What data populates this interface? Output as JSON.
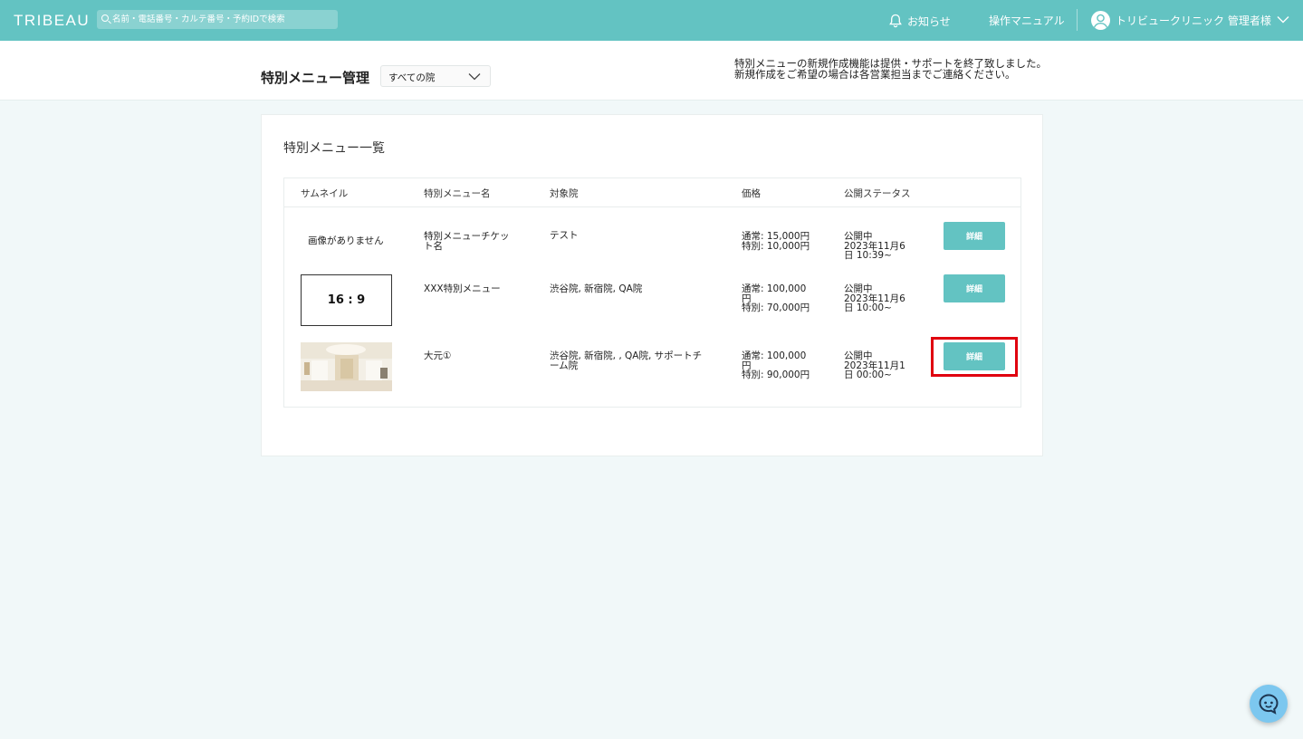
{
  "topbar": {
    "brand": "TRIBEAU",
    "search_placeholder": "名前・電話番号・カルテ番号・予約IDで検索",
    "notifications_label": "お知らせ",
    "manual_label": "操作マニュアル",
    "user_label": "トリビュークリニック 管理者様",
    "colors": {
      "bar": "#63c3c2"
    }
  },
  "subheader": {
    "title": "特別メニュー管理",
    "clinic_select": "すべての院",
    "notice_line1": "特別メニューの新規作成機能は提供・サポートを終了致しました。",
    "notice_line2": "新規作成をご希望の場合は各営業担当までご連絡ください。"
  },
  "card": {
    "title": "特別メニュー一覧",
    "columns": [
      "サムネイル",
      "特別メニュー名",
      "対象院",
      "価格",
      "公開ステータス"
    ],
    "rows": [
      {
        "thumbnail": "画像がありません",
        "name_l1": "特別メニューチケッ",
        "name_l2": "ト名",
        "clinics_l1": "テスト",
        "clinics_l2": "",
        "price_l1": "通常: 15,000円",
        "price_l2": "特別: 10,000円",
        "price_l3": "",
        "status_l1": "公開中",
        "status_l2": "2023年11月6",
        "status_l3": "日 10:39~",
        "button": "詳細"
      },
      {
        "thumbnail": "16 : 9",
        "name_l1": "XXX特別メニュー",
        "name_l2": "",
        "clinics_l1": "渋谷院, 新宿院, QA院",
        "clinics_l2": "",
        "price_l1": "通常: 100,000",
        "price_l2": "円",
        "price_l3": "特別: 70,000円",
        "status_l1": "公開中",
        "status_l2": "2023年11月6",
        "status_l3": "日 10:00~",
        "button": "詳細"
      },
      {
        "thumbnail": "",
        "name_l1": "大元①",
        "name_l2": "",
        "clinics_l1": "渋谷院, 新宿院, , QA院, サポートチ",
        "clinics_l2": "ーム院",
        "price_l1": "通常: 100,000",
        "price_l2": "円",
        "price_l3": "特別: 90,000円",
        "status_l1": "公開中",
        "status_l2": "2023年11月1",
        "status_l3": "日 00:00~",
        "button": "詳細"
      }
    ],
    "colors": {
      "button": "#63c3c2",
      "highlight": "#e0000f"
    }
  }
}
